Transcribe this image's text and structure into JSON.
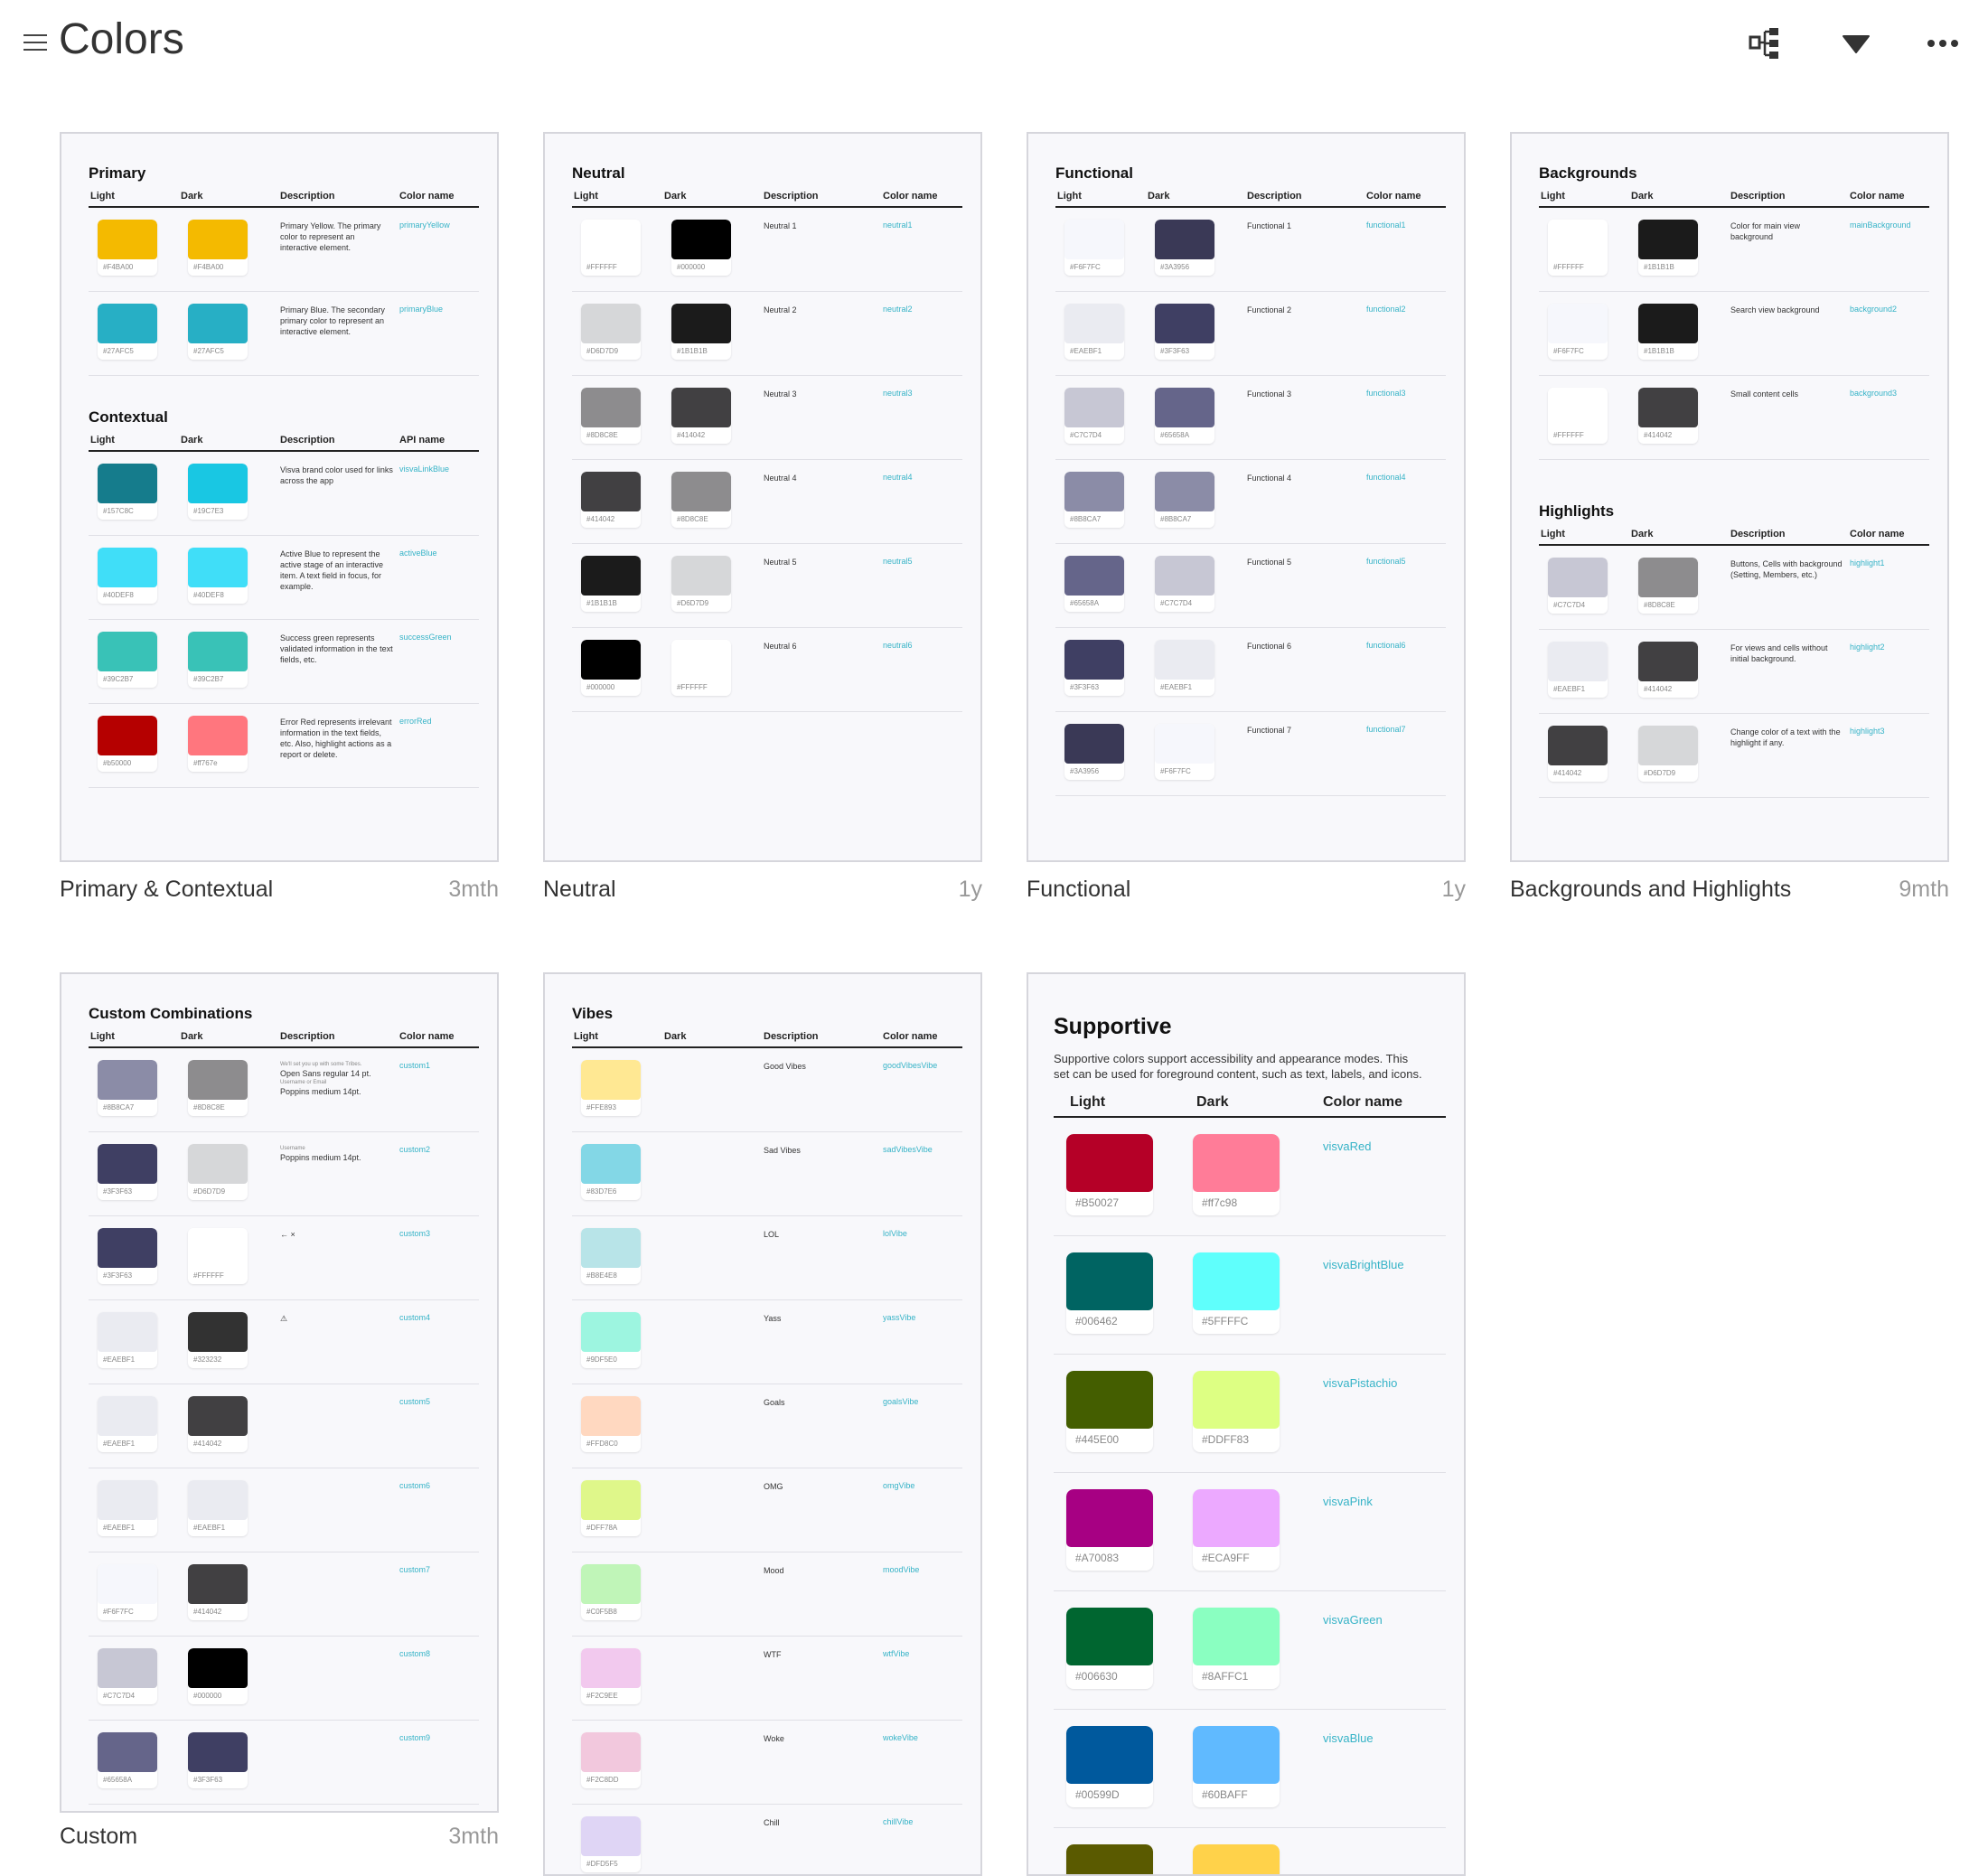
{
  "header": {
    "title": "Colors"
  },
  "boards": [
    {
      "caption": "Primary & Contextual",
      "ago": "3mth"
    },
    {
      "caption": "Neutral",
      "ago": "1y"
    },
    {
      "caption": "Functional",
      "ago": "1y"
    },
    {
      "caption": "Backgrounds and Highlights",
      "ago": "9mth"
    },
    {
      "caption": "Custom",
      "ago": "3mth"
    },
    {
      "caption": "Vibes",
      "ago": ""
    },
    {
      "caption": "",
      "ago": ""
    }
  ],
  "colors": {
    "accent": "#36b3c7",
    "board_bg": "#f8f8fb",
    "rule": "#222222"
  },
  "primary": {
    "title": "Primary",
    "headers": [
      "Light",
      "Dark",
      "Description",
      "Color name"
    ],
    "rows": [
      {
        "light": "#F4BA00",
        "light_hex": "#F4BA00",
        "dark": "#F4BA00",
        "dark_hex": "#F4BA00",
        "desc": "Primary Yellow. The primary color to represent an interactive element.",
        "name": "primaryYellow"
      },
      {
        "light": "#27AFC5",
        "light_hex": "#27AFC5",
        "dark": "#27AFC5",
        "dark_hex": "#27AFC5",
        "desc": "Primary Blue. The secondary primary color to represent an interactive element.",
        "name": "primaryBlue"
      }
    ]
  },
  "contextual": {
    "title": "Contextual",
    "headers": [
      "Light",
      "Dark",
      "Description",
      "API name"
    ],
    "rows": [
      {
        "light": "#157C8C",
        "light_hex": "#157C8C",
        "dark": "#19C7E3",
        "dark_hex": "#19C7E3",
        "desc": "Visva brand color used for links across the app",
        "name": "visvaLinkBlue"
      },
      {
        "light": "#40DEF8",
        "light_hex": "#40DEF8",
        "dark": "#40DEF8",
        "dark_hex": "#40DEF8",
        "desc": "Active Blue to represent the active stage of an interactive item. A text field in focus, for example.",
        "name": "activeBlue"
      },
      {
        "light": "#39C2B7",
        "light_hex": "#39C2B7",
        "dark": "#39C2B7",
        "dark_hex": "#39C2B7",
        "desc": "Success green represents validated information in the text fields, etc.",
        "name": "successGreen"
      },
      {
        "light": "#b50000",
        "light_hex": "#b50000",
        "dark": "#ff767e",
        "dark_hex": "#ff767e",
        "desc": "Error Red represents irrelevant information in the text fields, etc. Also, highlight actions as a report or delete.",
        "name": "errorRed"
      }
    ]
  },
  "neutral": {
    "title": "Neutral",
    "headers": [
      "Light",
      "Dark",
      "Description",
      "Color name"
    ],
    "rows": [
      {
        "light": "#FFFFFF",
        "light_hex": "#FFFFFF",
        "dark": "#000000",
        "dark_hex": "#000000",
        "desc": "Neutral 1",
        "name": "neutral1"
      },
      {
        "light": "#D6D7D9",
        "light_hex": "#D6D7D9",
        "dark": "#1B1B1B",
        "dark_hex": "#1B1B1B",
        "desc": "Neutral 2",
        "name": "neutral2"
      },
      {
        "light": "#8D8C8E",
        "light_hex": "#8D8C8E",
        "dark": "#414042",
        "dark_hex": "#414042",
        "desc": "Neutral 3",
        "name": "neutral3"
      },
      {
        "light": "#414042",
        "light_hex": "#414042",
        "dark": "#8D8C8E",
        "dark_hex": "#8D8C8E",
        "desc": "Neutral 4",
        "name": "neutral4"
      },
      {
        "light": "#1B1B1B",
        "light_hex": "#1B1B1B",
        "dark": "#D6D7D9",
        "dark_hex": "#D6D7D9",
        "desc": "Neutral 5",
        "name": "neutral5"
      },
      {
        "light": "#000000",
        "light_hex": "#000000",
        "dark": "#FFFFFF",
        "dark_hex": "#FFFFFF",
        "desc": "Neutral 6",
        "name": "neutral6"
      }
    ]
  },
  "functional": {
    "title": "Functional",
    "headers": [
      "Light",
      "Dark",
      "Description",
      "Color name"
    ],
    "rows": [
      {
        "light": "#F6F7FC",
        "light_hex": "#F6F7FC",
        "dark": "#3A3956",
        "dark_hex": "#3A3956",
        "desc": "Functional 1",
        "name": "functional1"
      },
      {
        "light": "#EAEBF1",
        "light_hex": "#EAEBF1",
        "dark": "#3F3F63",
        "dark_hex": "#3F3F63",
        "desc": "Functional 2",
        "name": "functional2"
      },
      {
        "light": "#C7C7D4",
        "light_hex": "#C7C7D4",
        "dark": "#65658A",
        "dark_hex": "#65658A",
        "desc": "Functional 3",
        "name": "functional3"
      },
      {
        "light": "#8B8CA7",
        "light_hex": "#8B8CA7",
        "dark": "#8B8CA7",
        "dark_hex": "#8B8CA7",
        "desc": "Functional 4",
        "name": "functional4"
      },
      {
        "light": "#65658A",
        "light_hex": "#65658A",
        "dark": "#C7C7D4",
        "dark_hex": "#C7C7D4",
        "desc": "Functional 5",
        "name": "functional5"
      },
      {
        "light": "#3F3F63",
        "light_hex": "#3F3F63",
        "dark": "#EAEBF1",
        "dark_hex": "#EAEBF1",
        "desc": "Functional 6",
        "name": "functional6"
      },
      {
        "light": "#3A3956",
        "light_hex": "#3A3956",
        "dark": "#F6F7FC",
        "dark_hex": "#F6F7FC",
        "desc": "Functional 7",
        "name": "functional7"
      }
    ]
  },
  "backgrounds": {
    "title": "Backgrounds",
    "headers": [
      "Light",
      "Dark",
      "Description",
      "Color name"
    ],
    "rows": [
      {
        "light": "#FFFFFF",
        "light_hex": "#FFFFFF",
        "dark": "#1B1B1B",
        "dark_hex": "#1B1B1B",
        "desc": "Color for main view background",
        "name": "mainBackground"
      },
      {
        "light": "#F6F7FC",
        "light_hex": "#F6F7FC",
        "dark": "#1B1B1B",
        "dark_hex": "#1B1B1B",
        "desc": "Search view background",
        "name": "background2"
      },
      {
        "light": "#FFFFFF",
        "light_hex": "#FFFFFF",
        "dark": "#414042",
        "dark_hex": "#414042",
        "desc": "Small content cells",
        "name": "background3"
      }
    ]
  },
  "highlights": {
    "title": "Highlights",
    "headers": [
      "Light",
      "Dark",
      "Description",
      "Color name"
    ],
    "rows": [
      {
        "light": "#C7C7D4",
        "light_hex": "#C7C7D4",
        "dark": "#8D8C8E",
        "dark_hex": "#8D8C8E",
        "desc": "Buttons, Cells with background (Setting, Members, etc.)",
        "name": "highlight1"
      },
      {
        "light": "#EAEBF1",
        "light_hex": "#EAEBF1",
        "dark": "#414042",
        "dark_hex": "#414042",
        "desc": "For views and cells without initial background.",
        "name": "highlight2"
      },
      {
        "light": "#414042",
        "light_hex": "#414042",
        "dark": "#D6D7D9",
        "dark_hex": "#D6D7D9",
        "desc": "Change color of a text with the highlight if any.",
        "name": "highlight3"
      }
    ]
  },
  "custom": {
    "title": "Custom Combinations",
    "headers": [
      "Light",
      "Dark",
      "Description",
      "Color name"
    ],
    "rows": [
      {
        "light": "#8B8CA7",
        "light_hex": "#8B8CA7",
        "dark": "#8D8C8E",
        "dark_hex": "#8D8C8E",
        "desc_sub1": "We'll set you up with some Tribes.",
        "desc1": "Open Sans regular 14 pt.",
        "desc_sub2": "Username or Email",
        "desc2": "Poppins medium 14pt.",
        "name": "custom1"
      },
      {
        "light": "#3F3F63",
        "light_hex": "#3F3F63",
        "dark": "#D6D7D9",
        "dark_hex": "#D6D7D9",
        "desc_sub1": "Username",
        "desc1": "Poppins medium 14pt.",
        "name": "custom2"
      },
      {
        "light": "#3F3F63",
        "light_hex": "#3F3F63",
        "dark": "#FFFFFF",
        "dark_hex": "#FFFFFF",
        "desc_icons": "← ×",
        "name": "custom3"
      },
      {
        "light": "#EAEBF1",
        "light_hex": "#EAEBF1",
        "dark": "#323232",
        "dark_hex": "#323232",
        "desc_icons": "⚠",
        "name": "custom4"
      },
      {
        "light": "#EAEBF1",
        "light_hex": "#EAEBF1",
        "dark": "#414042",
        "dark_hex": "#414042",
        "name": "custom5"
      },
      {
        "light": "#EAEBF1",
        "light_hex": "#EAEBF1",
        "dark": "#EAEBF1",
        "dark_hex": "#EAEBF1",
        "name": "custom6"
      },
      {
        "light": "#F6F7FC",
        "light_hex": "#F6F7FC",
        "dark": "#414042",
        "dark_hex": "#414042",
        "name": "custom7"
      },
      {
        "light": "#C7C7D4",
        "light_hex": "#C7C7D4",
        "dark": "#000000",
        "dark_hex": "#000000",
        "name": "custom8"
      },
      {
        "light": "#65658A",
        "light_hex": "#65658A",
        "dark": "#3F3F63",
        "dark_hex": "#3F3F63",
        "name": "custom9"
      }
    ]
  },
  "vibes": {
    "title": "Vibes",
    "headers": [
      "Light",
      "Dark",
      "Description",
      "Color name"
    ],
    "rows": [
      {
        "light": "#FFE893",
        "light_hex": "#FFE893",
        "desc": "Good Vibes",
        "name": "goodVibesVibe"
      },
      {
        "light": "#83D7E6",
        "light_hex": "#83D7E6",
        "desc": "Sad Vibes",
        "name": "sadVibesVibe"
      },
      {
        "light": "#B8E4E8",
        "light_hex": "#B8E4E8",
        "desc": "LOL",
        "name": "lolVibe"
      },
      {
        "light": "#9DF5E0",
        "light_hex": "#9DF5E0",
        "desc": "Yass",
        "name": "yassVibe"
      },
      {
        "light": "#FFD8C0",
        "light_hex": "#FFD8C0",
        "desc": "Goals",
        "name": "goalsVibe"
      },
      {
        "light": "#DFF78A",
        "light_hex": "#DFF78A",
        "desc": "OMG",
        "name": "omgVibe"
      },
      {
        "light": "#C0F5B8",
        "light_hex": "#C0F5B8",
        "desc": "Mood",
        "name": "moodVibe"
      },
      {
        "light": "#F2C9EE",
        "light_hex": "#F2C9EE",
        "desc": "WTF",
        "name": "wtfVibe"
      },
      {
        "light": "#F2C8DD",
        "light_hex": "#F2C8DD",
        "desc": "Woke",
        "name": "wokeVibe"
      },
      {
        "light": "#DFD5F5",
        "light_hex": "#DFD5F5",
        "desc": "Chill",
        "name": "chillVibe"
      }
    ]
  },
  "supportive": {
    "title": "Supportive",
    "intro": "Supportive colors support accessibility and appearance modes. This set can be used for foreground content, such as text, labels, and icons.",
    "headers": [
      "Light",
      "Dark",
      "Color name"
    ],
    "rows": [
      {
        "light": "#B50027",
        "light_hex": "#B50027",
        "dark": "#ff7c98",
        "dark_hex": "#ff7c98",
        "name": "visvaRed"
      },
      {
        "light": "#006462",
        "light_hex": "#006462",
        "dark": "#5FFFFC",
        "dark_hex": "#5FFFFC",
        "name": "visvaBrightBlue"
      },
      {
        "light": "#445E00",
        "light_hex": "#445E00",
        "dark": "#DDFF83",
        "dark_hex": "#DDFF83",
        "name": "visvaPistachio"
      },
      {
        "light": "#A70083",
        "light_hex": "#A70083",
        "dark": "#ECA9FF",
        "dark_hex": "#ECA9FF",
        "name": "visvaPink"
      },
      {
        "light": "#006630",
        "light_hex": "#006630",
        "dark": "#8AFFC1",
        "dark_hex": "#8AFFC1",
        "name": "visvaGreen"
      },
      {
        "light": "#00599D",
        "light_hex": "#00599D",
        "dark": "#60BAFF",
        "dark_hex": "#60BAFF",
        "name": "visvaBlue"
      },
      {
        "light": "#5A5A00",
        "light_hex": "",
        "dark": "#FFD24A",
        "dark_hex": "",
        "name": ""
      }
    ]
  },
  "icons": [
    "hamburger-menu-icon",
    "prototype-flow-icon",
    "download-icon",
    "more-options-icon"
  ]
}
